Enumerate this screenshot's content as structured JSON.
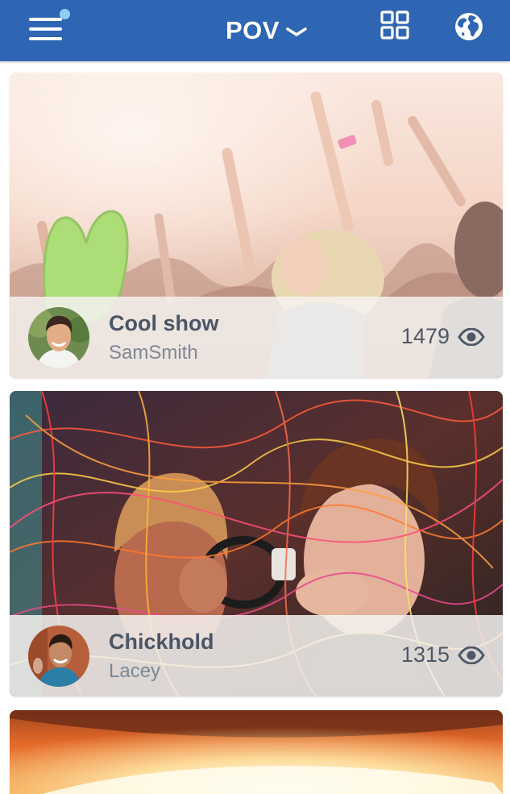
{
  "header": {
    "title": "POV",
    "bar_color": "#2e66b4",
    "notification_dot_color": "#8fd0f2",
    "menu_icon": "hamburger-menu-icon",
    "title_dropdown_icon": "chevron-down-icon",
    "grid_icon": "grid-view-icon",
    "globe_icon": "globe-icon"
  },
  "feed": [
    {
      "title": "Cool show",
      "user": "SamSmith",
      "views": "1479",
      "views_icon": "eye-icon",
      "image": "concert-crowd-photo"
    },
    {
      "title": "Chickhold",
      "user": "Lacey",
      "views": "1315",
      "views_icon": "eye-icon",
      "image": "light-trails-selfie-photo"
    },
    {
      "image": "stage-lights-photo"
    }
  ]
}
